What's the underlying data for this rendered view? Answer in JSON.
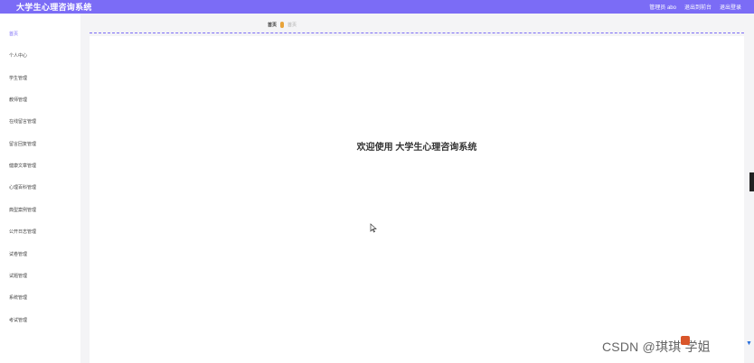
{
  "header": {
    "app_title": "大学生心理咨询系统",
    "admin_user": "管理员 abo",
    "exit_to_frontend": "退出到前台",
    "logout": "退出登录"
  },
  "sidebar": {
    "items": [
      {
        "label": "首页"
      },
      {
        "label": "个人中心"
      },
      {
        "label": "学生管理"
      },
      {
        "label": "教师管理"
      },
      {
        "label": "在线留言管理"
      },
      {
        "label": "留言回复管理"
      },
      {
        "label": "健康文章管理"
      },
      {
        "label": "心理百科管理"
      },
      {
        "label": "典型案例管理"
      },
      {
        "label": "公开日志管理"
      },
      {
        "label": "试卷管理"
      },
      {
        "label": "试题管理"
      },
      {
        "label": "系统管理"
      },
      {
        "label": "考试管理"
      }
    ]
  },
  "breadcrumb": {
    "home": "首页",
    "current": "首页"
  },
  "main": {
    "welcome": "欢迎使用 大学生心理咨询系统"
  },
  "watermark": "CSDN @琪琪 学姐",
  "colors": {
    "accent": "#7b6cf6",
    "breadcrumb_sep": "#e8a33a"
  }
}
